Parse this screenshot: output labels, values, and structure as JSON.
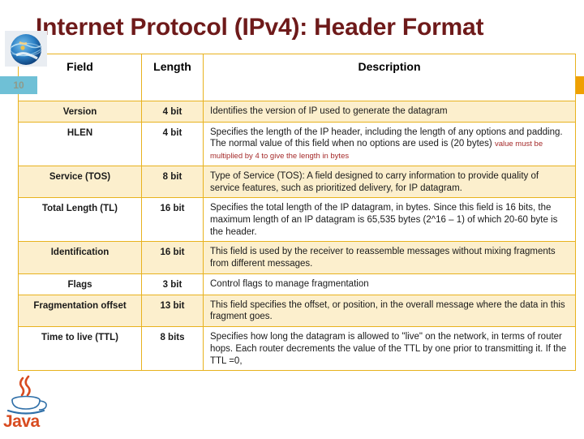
{
  "slide": {
    "title": "Internet Protocol (IPv4): Header Format",
    "number": "10",
    "title_color": "#6E1A1A",
    "accent_color": "#EFA003",
    "row_alt_color": "#FCEFCD",
    "border_color": "#E8B21E",
    "badge_color": "#6FC0D6"
  },
  "logos": {
    "globe_icon": "globe-icon",
    "java_icon": "java-coffee-cup-icon",
    "java_wordmark": "Java"
  },
  "table": {
    "headers": [
      "Field",
      "Length",
      "Description"
    ],
    "rows": [
      {
        "field": "Version",
        "length": "4 bit",
        "description": "Identifies the version of IP used to generate the datagram",
        "note": ""
      },
      {
        "field": "HLEN",
        "length": "4 bit",
        "description": "Specifies the length of the IP header, including the length of any options and padding. The normal value of this field when no options are used is (20 bytes)",
        "note": "value must be multiplied by 4 to give the length in bytes"
      },
      {
        "field": "Service (TOS)",
        "length": "8 bit",
        "description": "Type of Service (TOS): A field designed to carry information to provide quality of service features, such as prioritized delivery, for IP datagram.",
        "note": ""
      },
      {
        "field": "Total Length (TL)",
        "length": "16 bit",
        "description": "Specifies the total length of the IP datagram, in bytes. Since this field is 16 bits, the maximum length of an IP datagram is 65,535 bytes (2^16 – 1) of which 20-60 byte is the header.",
        "note": ""
      },
      {
        "field": "Identification",
        "length": "16 bit",
        "description": "This field is used by the receiver to reassemble messages without mixing fragments from different messages.",
        "note": ""
      },
      {
        "field": "Flags",
        "length": "3 bit",
        "description": "Control flags to manage fragmentation",
        "note": ""
      },
      {
        "field": "Fragmentation offset",
        "length": "13 bit",
        "description": "This field specifies the offset, or position, in the overall message where the data in this fragment goes.",
        "note": ""
      },
      {
        "field": "Time to live (TTL)",
        "length": "8 bits",
        "description": "Specifies how long the datagram is allowed to \"live\" on the network, in terms of router hops. Each router decrements the value of the TTL by one prior to transmitting it. If the TTL =0,",
        "note": ""
      }
    ]
  }
}
